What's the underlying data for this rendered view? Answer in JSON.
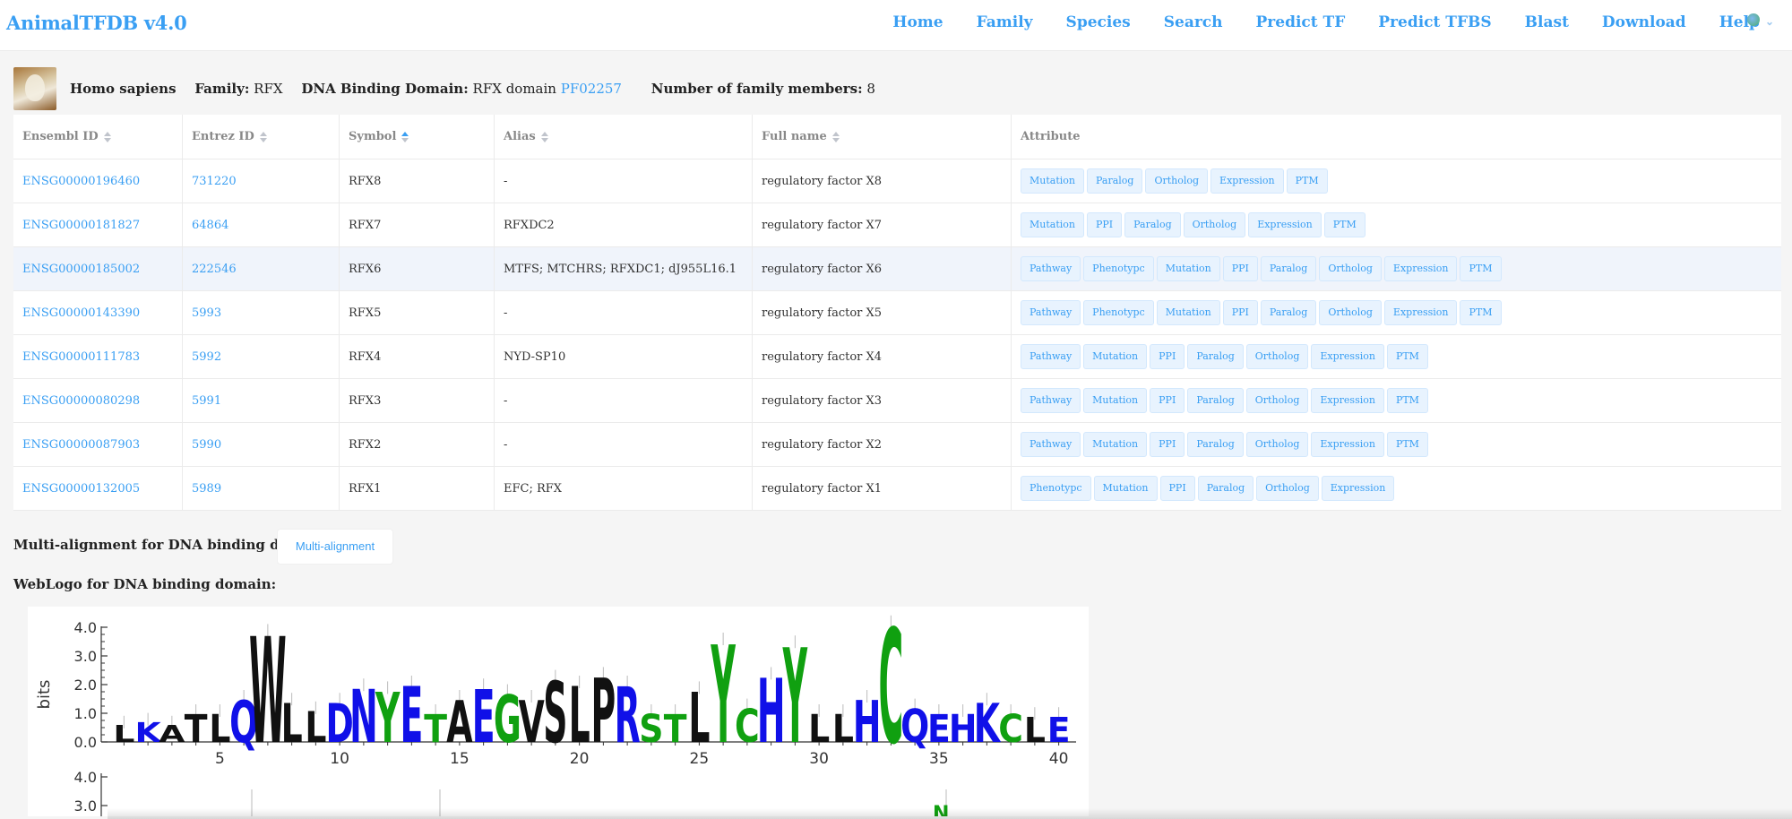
{
  "nav": {
    "brand": "AnimalTFDB v4.0",
    "items": [
      "Home",
      "Family",
      "Species",
      "Search",
      "Predict TF",
      "Predict TFBS",
      "Blast",
      "Download",
      "Help"
    ]
  },
  "info": {
    "species": "Homo sapiens",
    "family_label": "Family:",
    "family_value": "RFX",
    "dbd_label": "DNA Binding Domain:",
    "dbd_value": "RFX domain",
    "dbd_link": "PF02257",
    "members_label": "Number of family members:",
    "members_value": "8"
  },
  "table": {
    "headers": [
      "Ensembl ID",
      "Entrez ID",
      "Symbol",
      "Alias",
      "Full name",
      "Attribute"
    ],
    "rows": [
      {
        "ensembl": "ENSG00000196460",
        "entrez": "731220",
        "symbol": "RFX8",
        "alias": "-",
        "full": "regulatory factor X8",
        "attrs": [
          "Mutation",
          "Paralog",
          "Ortholog",
          "Expression",
          "PTM"
        ]
      },
      {
        "ensembl": "ENSG00000181827",
        "entrez": "64864",
        "symbol": "RFX7",
        "alias": "RFXDC2",
        "full": "regulatory factor X7",
        "attrs": [
          "Mutation",
          "PPI",
          "Paralog",
          "Ortholog",
          "Expression",
          "PTM"
        ]
      },
      {
        "ensembl": "ENSG00000185002",
        "entrez": "222546",
        "symbol": "RFX6",
        "alias": "MTFS; MTCHRS; RFXDC1; dJ955L16.1",
        "full": "regulatory factor X6",
        "attrs": [
          "Pathway",
          "Phenotypc",
          "Mutation",
          "PPI",
          "Paralog",
          "Ortholog",
          "Expression",
          "PTM"
        ]
      },
      {
        "ensembl": "ENSG00000143390",
        "entrez": "5993",
        "symbol": "RFX5",
        "alias": "-",
        "full": "regulatory factor X5",
        "attrs": [
          "Pathway",
          "Phenotypc",
          "Mutation",
          "PPI",
          "Paralog",
          "Ortholog",
          "Expression",
          "PTM"
        ]
      },
      {
        "ensembl": "ENSG00000111783",
        "entrez": "5992",
        "symbol": "RFX4",
        "alias": "NYD-SP10",
        "full": "regulatory factor X4",
        "attrs": [
          "Pathway",
          "Mutation",
          "PPI",
          "Paralog",
          "Ortholog",
          "Expression",
          "PTM"
        ]
      },
      {
        "ensembl": "ENSG00000080298",
        "entrez": "5991",
        "symbol": "RFX3",
        "alias": "-",
        "full": "regulatory factor X3",
        "attrs": [
          "Pathway",
          "Mutation",
          "PPI",
          "Paralog",
          "Ortholog",
          "Expression",
          "PTM"
        ]
      },
      {
        "ensembl": "ENSG00000087903",
        "entrez": "5990",
        "symbol": "RFX2",
        "alias": "-",
        "full": "regulatory factor X2",
        "attrs": [
          "Pathway",
          "Mutation",
          "PPI",
          "Paralog",
          "Ortholog",
          "Expression",
          "PTM"
        ]
      },
      {
        "ensembl": "ENSG00000132005",
        "entrez": "5989",
        "symbol": "RFX1",
        "alias": "EFC; RFX",
        "full": "regulatory factor X1",
        "attrs": [
          "Phenotypc",
          "Mutation",
          "PPI",
          "Paralog",
          "Ortholog",
          "Expression"
        ]
      }
    ]
  },
  "multialign": {
    "label": "Multi-alignment for DNA binding domain:",
    "button": "Multi-alignment"
  },
  "weblogo": {
    "label": "WebLogo for DNA binding domain:",
    "ylabel": "bits",
    "yticks": [
      "4.0",
      "3.0",
      "2.0",
      "1.0",
      "0.0"
    ],
    "yticks2": [
      "4.0",
      "3.0"
    ],
    "xticks": [
      "5",
      "10",
      "15",
      "20",
      "25",
      "30",
      "35",
      "40"
    ],
    "letters": [
      "L",
      "K",
      "A",
      "T",
      "L",
      "Q",
      "W",
      "L",
      "L",
      "D",
      "N",
      "Y",
      "E",
      "T",
      "A",
      "E",
      "G",
      "V",
      "S",
      "L",
      "P",
      "R",
      "S",
      "T",
      "L",
      "Y",
      "C",
      "H",
      "Y",
      "L",
      "L",
      "H",
      "C",
      "Q",
      "E",
      "H",
      "K",
      "C",
      "L",
      "E"
    ],
    "colors": {
      "blue": "#1010e8",
      "green": "#10a010",
      "black": "#111111"
    }
  }
}
